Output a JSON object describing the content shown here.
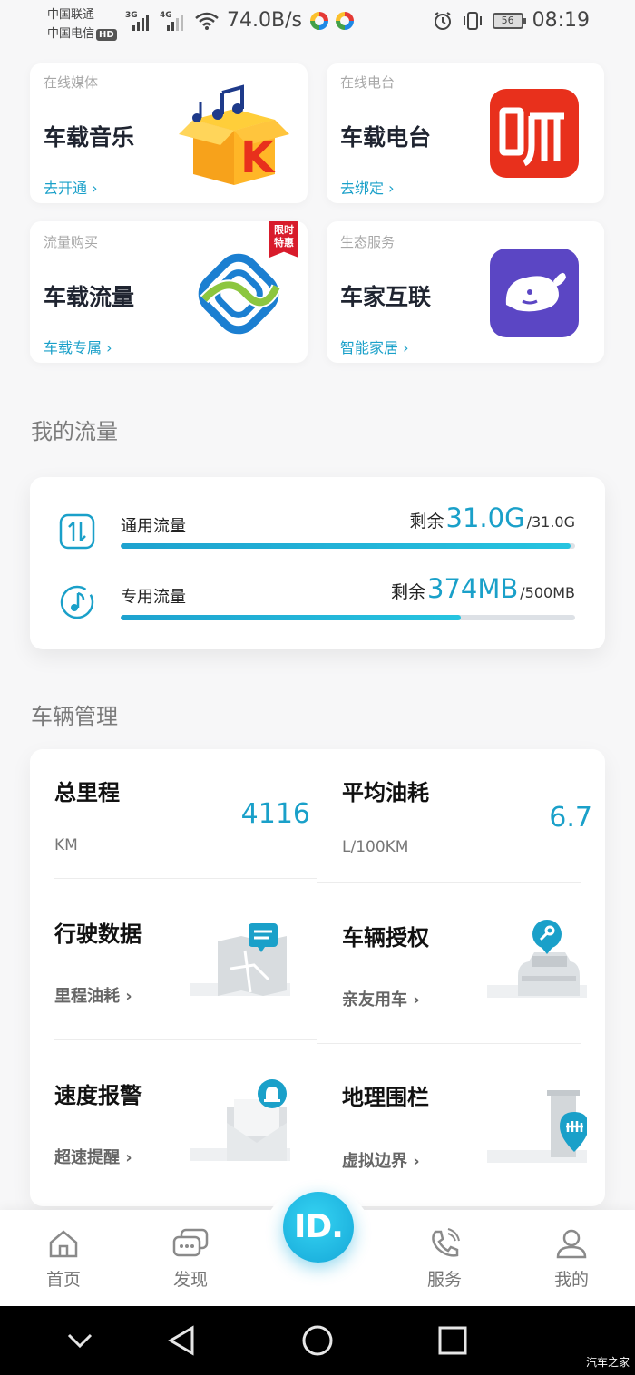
{
  "status_bar": {
    "carrier1": "中国联通",
    "carrier2": "中国电信",
    "hd": "HD",
    "signal1": "3G",
    "signal2": "4G",
    "net_speed": "74.0B/s",
    "battery": "56",
    "time": "08:19"
  },
  "services": [
    {
      "category": "在线媒体",
      "title": "车载音乐",
      "link": "去开通 ›"
    },
    {
      "category": "在线电台",
      "title": "车载电台",
      "link": "去绑定 ›"
    },
    {
      "category": "流量购买",
      "title": "车载流量",
      "link": "车载专属 ›",
      "tag": [
        "限时",
        "特惠"
      ]
    },
    {
      "category": "生态服务",
      "title": "车家互联",
      "link": "智能家居 ›"
    }
  ],
  "my_data": {
    "title": "我的流量",
    "rows": [
      {
        "name": "通用流量",
        "prefix": "剩余",
        "remaining": "31.0G",
        "total": "/31.0G",
        "fraction": 0.99
      },
      {
        "name": "专用流量",
        "prefix": "剩余",
        "remaining": "374MB",
        "total": "/500MB",
        "fraction": 0.748
      }
    ]
  },
  "vehicle": {
    "title": "车辆管理",
    "mileage": {
      "title": "总里程",
      "value": "4116",
      "unit": "KM"
    },
    "fuel": {
      "title": "平均油耗",
      "value": "6.7",
      "unit": "L/100KM"
    },
    "driving": {
      "title": "行驶数据",
      "sub": "里程油耗 ›"
    },
    "auth": {
      "title": "车辆授权",
      "sub": "亲友用车 ›"
    },
    "speed": {
      "title": "速度报警",
      "sub": "超速提醒 ›"
    },
    "fence": {
      "title": "地理围栏",
      "sub": "虚拟边界 ›"
    }
  },
  "nav": {
    "home": "首页",
    "discover": "发现",
    "id": "ID.",
    "service": "服务",
    "mine": "我的"
  },
  "watermark": "汽车之家",
  "colors": {
    "accent": "#1aa0c9",
    "radio_red": "#e8301c",
    "music_orange": "#f7a21b",
    "cmcc_blue": "#1b7fd1",
    "whale_purple": "#5b46c4"
  }
}
